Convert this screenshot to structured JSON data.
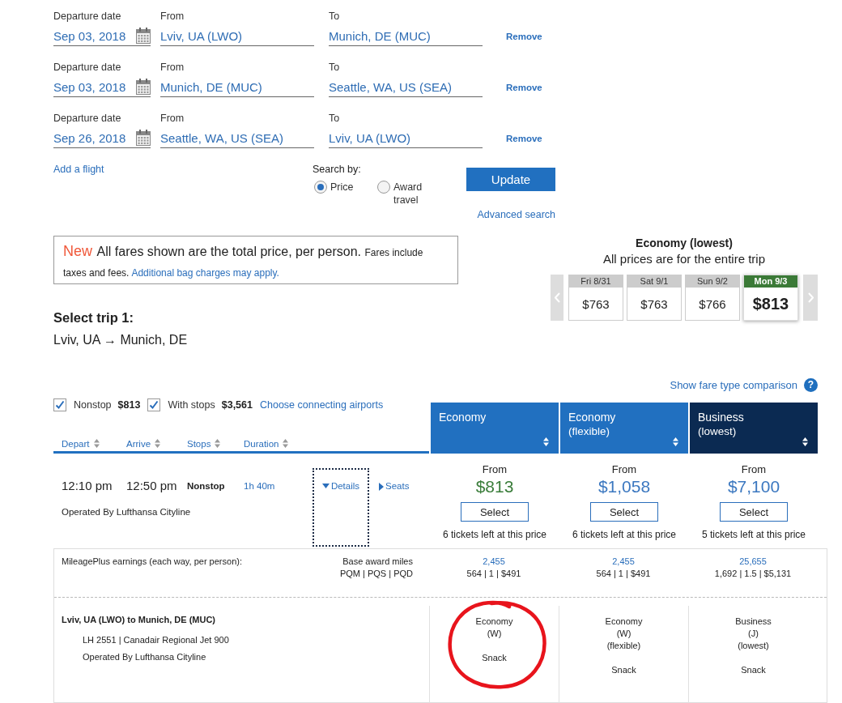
{
  "trips": [
    {
      "date_label": "Departure date",
      "date": "Sep 03, 2018",
      "from_label": "From",
      "from": "Lviv, UA (LWO)",
      "to_label": "To",
      "to": "Munich, DE (MUC)",
      "remove": "Remove"
    },
    {
      "date_label": "Departure date",
      "date": "Sep 03, 2018",
      "from_label": "From",
      "from": "Munich, DE (MUC)",
      "to_label": "To",
      "to": "Seattle, WA, US (SEA)",
      "remove": "Remove"
    },
    {
      "date_label": "Departure date",
      "date": "Sep 26, 2018",
      "from_label": "From",
      "from": "Seattle, WA, US (SEA)",
      "to_label": "To",
      "to": "Lviv, UA (LWO)",
      "remove": "Remove"
    }
  ],
  "add_flight": "Add a flight",
  "search_by": {
    "label": "Search by:",
    "options": [
      {
        "label": "Price",
        "selected": true
      },
      {
        "label": "Award travel",
        "selected": false
      }
    ]
  },
  "update_button": "Update",
  "advanced_search": "Advanced search",
  "notice": {
    "badge": "New",
    "headline": "All fares shown are the total price, per person.",
    "detail": "Fares include taxes and fees.",
    "link": "Additional bag charges may apply."
  },
  "trip_heading": {
    "title": "Select trip 1:",
    "route": "Lviv, UA → Munich, DE"
  },
  "fare_calendar": {
    "title": "Economy (lowest)",
    "subtitle": "All prices are for the entire trip",
    "days": [
      {
        "day": "Fri 8/31",
        "price": "$763",
        "selected": false
      },
      {
        "day": "Sat 9/1",
        "price": "$763",
        "selected": false
      },
      {
        "day": "Sun 9/2",
        "price": "$766",
        "selected": false
      },
      {
        "day": "Mon 9/3",
        "price": "$813",
        "selected": true
      }
    ]
  },
  "fare_comparison": {
    "link": "Show fare type comparison",
    "help": "?"
  },
  "filters": [
    {
      "label": "Nonstop",
      "price": "$813",
      "checked": true
    },
    {
      "label": "With stops",
      "price": "$3,561",
      "checked": true
    }
  ],
  "connecting_link": "Choose connecting airports",
  "sort_columns": [
    "Depart",
    "Arrive",
    "Stops",
    "Duration"
  ],
  "fare_columns": [
    {
      "title": "Economy",
      "kind": "economy"
    },
    {
      "title": "Economy",
      "subtitle": "(flexible)",
      "kind": "economy"
    },
    {
      "title": "Business",
      "subtitle": "(lowest)",
      "kind": "business"
    }
  ],
  "flight": {
    "depart": "12:10 pm",
    "arrive": "12:50 pm",
    "stops": "Nonstop",
    "duration": "1h 40m",
    "operator": "Operated By Lufthansa Cityline",
    "details": {
      "label": "Details",
      "expanded": true,
      "focused": true
    },
    "seats": {
      "label": "Seats",
      "expanded": false
    },
    "fares": [
      {
        "from": "From",
        "price": "$813",
        "lowest": true,
        "button": "Select",
        "availability": "6 tickets left at this price"
      },
      {
        "from": "From",
        "price": "$1,058",
        "lowest": false,
        "button": "Select",
        "availability": "6 tickets left at this price"
      },
      {
        "from": "From",
        "price": "$7,100",
        "lowest": false,
        "button": "Select",
        "availability": "5 tickets left at this price"
      }
    ]
  },
  "earnings": {
    "label": "MileagePlus earnings (each way, per person):",
    "miles_label": "Base award miles",
    "qualifying_label": "PQM | PQS | PQD",
    "columns": [
      {
        "miles": "2,455",
        "qualifying": "564 | 1 | $491"
      },
      {
        "miles": "2,455",
        "qualifying": "564 | 1 | $491"
      },
      {
        "miles": "25,655",
        "qualifying": "1,692 | 1.5 | $5,131"
      }
    ]
  },
  "segment": {
    "route": "Lviv, UA (LWO) to Munich, DE (MUC)",
    "flight_info": "LH 2551 | Canadair Regional Jet 900",
    "operator": "Operated By Lufthansa Cityline",
    "cabins": [
      {
        "cabin": "Economy",
        "code": "(W)",
        "note": "Snack",
        "circled": true
      },
      {
        "cabin": "Economy",
        "code": "(W)",
        "fare": "(flexible)",
        "note": "Snack",
        "circled": false
      },
      {
        "cabin": "Business",
        "code": "(J)",
        "fare": "(lowest)",
        "note": "Snack",
        "circled": false
      }
    ]
  }
}
